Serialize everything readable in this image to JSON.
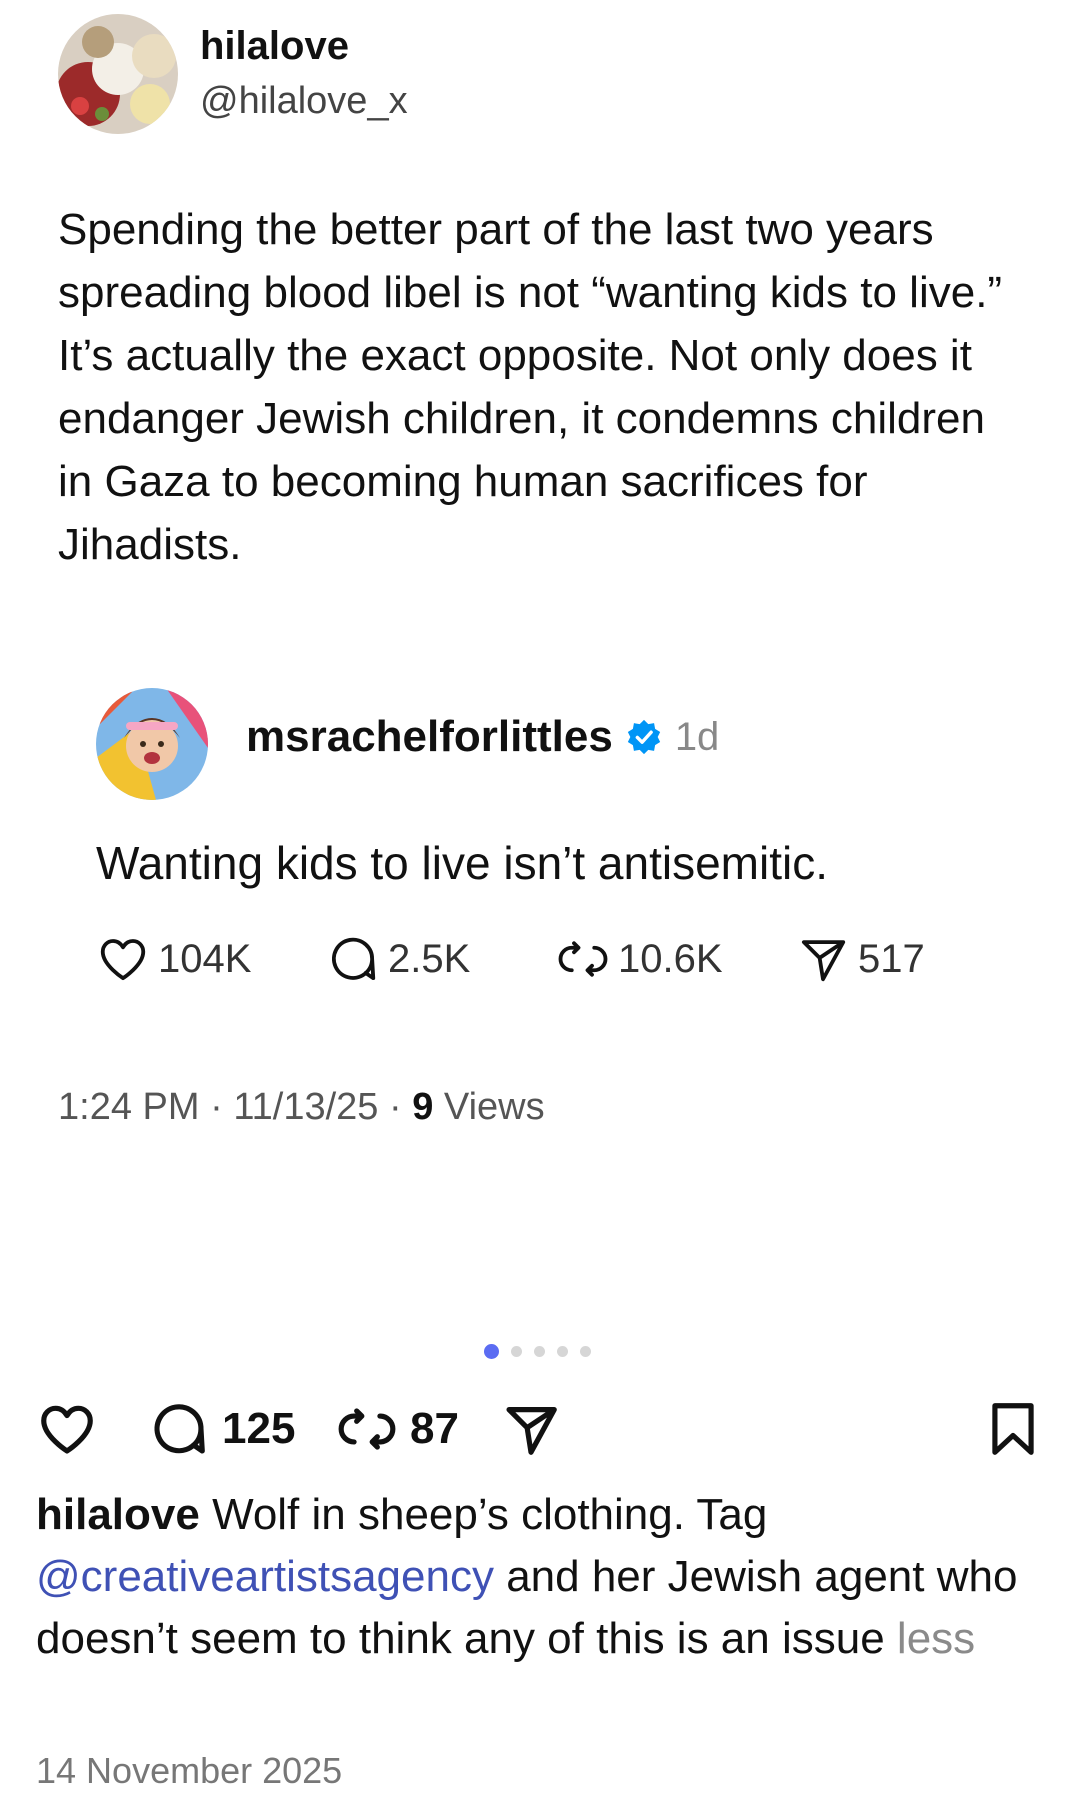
{
  "tweet": {
    "author_name": "hilalove",
    "author_handle": "@hilalove_x",
    "text": "Spending the better part of the last two years spreading blood libel is not “wanting kids to live.” It’s actually the exact opposite. Not only does it endanger Jewish children, it condemns children in Gaza to becoming human sacrifices for Jihadists.",
    "time": "1:24 PM",
    "date": "11/13/25",
    "views_count": "9",
    "views_label": "Views"
  },
  "quoted_post": {
    "author_name": "msrachelforlittles",
    "verified": true,
    "age": "1d",
    "text": "Wanting kids to live isn’t antisemitic.",
    "likes": "104K",
    "replies": "2.5K",
    "reposts": "10.6K",
    "shares": "517"
  },
  "carousel": {
    "total": 5,
    "active_index": 0
  },
  "instagram": {
    "comments": "125",
    "reposts": "87",
    "caption_user": "hilalove",
    "caption_text_1": "Wolf in sheep’s clothing. Tag",
    "caption_mention": "@creativeartistsagency",
    "caption_text_2": "and her Jewish agent who doesn’t seem to think any of this is an issue",
    "caption_less": "less",
    "post_date": "14 November 2025"
  },
  "colors": {
    "accent": "#5b6cf2",
    "mention": "#3f51b5",
    "verified": "#0095f6"
  },
  "icons": [
    "heart-icon",
    "comment-icon",
    "repost-icon",
    "share-icon",
    "bookmark-icon",
    "verified-icon"
  ]
}
